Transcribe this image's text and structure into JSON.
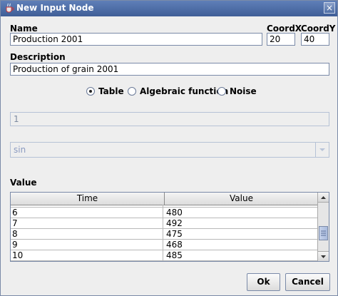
{
  "window": {
    "title": "New Input Node",
    "close_glyph": "×"
  },
  "name": {
    "label": "Name",
    "value": "Production 2001"
  },
  "coord_x": {
    "label": "CoordX",
    "value": "20"
  },
  "coord_y": {
    "label": "CoordY",
    "value": "40"
  },
  "description": {
    "label": "Description",
    "value": "Production of grain 2001"
  },
  "source_type": {
    "options": [
      {
        "label": "Table",
        "selected": true
      },
      {
        "label": "Algebraic function",
        "selected": false
      },
      {
        "label": "Noise",
        "selected": false
      }
    ]
  },
  "expression_field": {
    "value": "1"
  },
  "function_select": {
    "value": "sin"
  },
  "value_section": {
    "label": "Value",
    "columns": [
      "Time",
      "Value"
    ],
    "rows": [
      [
        "6",
        "480"
      ],
      [
        "7",
        "492"
      ],
      [
        "8",
        "475"
      ],
      [
        "9",
        "468"
      ],
      [
        "10",
        "485"
      ]
    ]
  },
  "buttons": {
    "ok": "Ok",
    "cancel": "Cancel"
  }
}
